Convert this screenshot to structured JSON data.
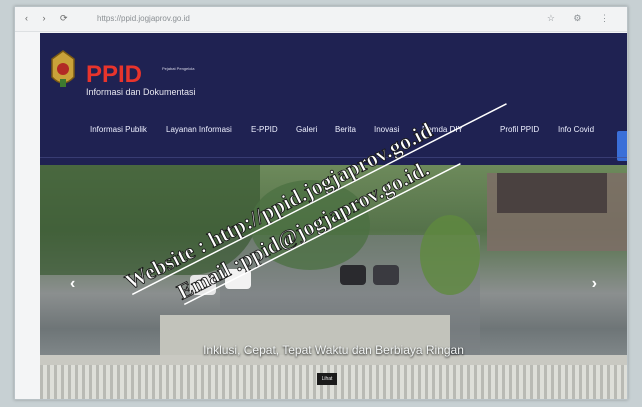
{
  "browser": {
    "url": "https://ppid.jogjaprov.go.id",
    "nav_glyphs": "‹ › ⟳",
    "tool_glyphs": "☆ ⚙ ⋮"
  },
  "header": {
    "brand": "PPID",
    "brand_small": "Pejabat Pengelola",
    "brand_sub": "Informasi dan Dokumentasi"
  },
  "menu": [
    "Informasi Publik",
    "Layanan Informasi",
    "E-PPID",
    "Galeri",
    "Berita",
    "Inovasi",
    "Pemda DIY",
    "Profil PPID",
    "Info Covid"
  ],
  "hero": {
    "caption": "Inklusi, Cepat, Tepat Waktu dan Berbiaya Ringan",
    "button": "Lihat",
    "prev": "‹",
    "next": "›"
  },
  "overlay": {
    "website": "Website : http://ppid.jogjaprov.go.id",
    "email": "Email :ppid@jogjaprov.go.id."
  },
  "colors": {
    "navy": "#1f2252",
    "brand_red": "#e8342c",
    "overlay_text": "#ffffff"
  }
}
